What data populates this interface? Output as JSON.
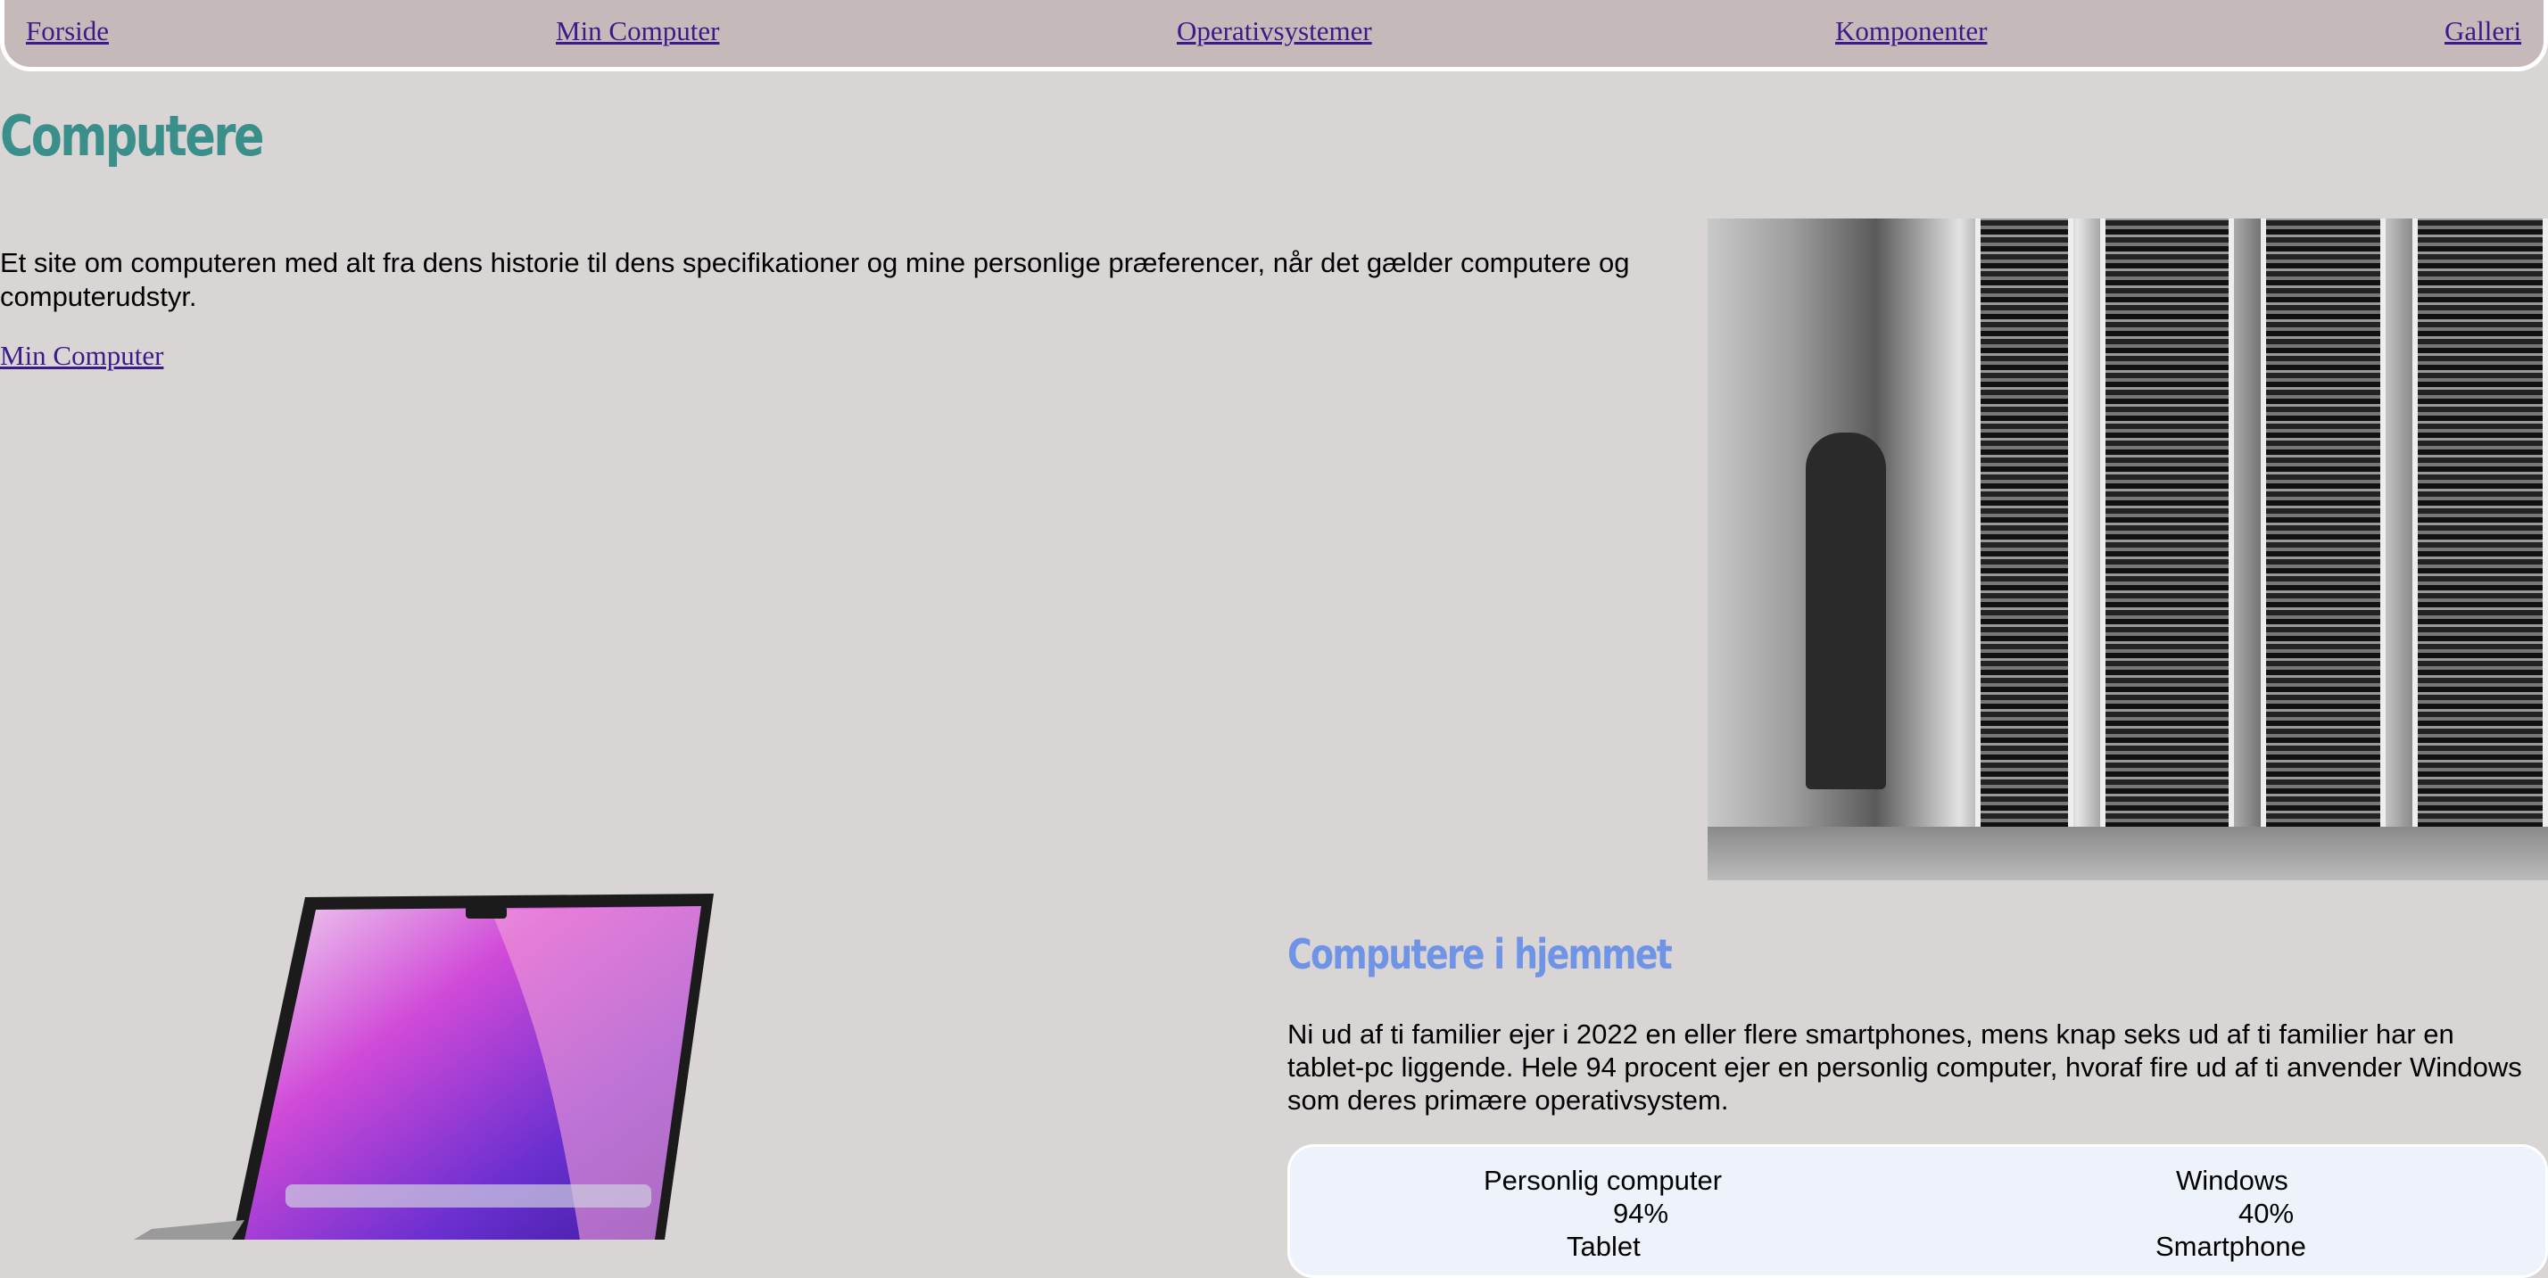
{
  "nav": {
    "items": [
      {
        "label": "Forside"
      },
      {
        "label": "Min Computer"
      },
      {
        "label": "Operativsystemer"
      },
      {
        "label": "Komponenter"
      },
      {
        "label": "Galleri"
      }
    ]
  },
  "main": {
    "title": "Computere",
    "intro": "Et site om computeren med alt fra dens historie til dens specifikationer og mine personlige præferencer, når det gælder computere og computerudstyr.",
    "link": "Min Computer"
  },
  "home": {
    "title": "Computere i hjemmet",
    "text": "Ni ud af ti familier ejer i 2022 en eller flere smartphones, mens knap seks ud af ti familier har en tablet-pc liggende. Hele 94 procent ejer en personlig computer, hvoraf fire ud af ti anvender Windows som deres primære operativsystem.",
    "stats": [
      {
        "label": "Personlig computer",
        "value": "94%"
      },
      {
        "label": "Windows",
        "value": "40%"
      },
      {
        "label": "Tablet"
      },
      {
        "label": "Smartphone"
      }
    ]
  },
  "images": {
    "photo": "historic-mainframe-computer-photo",
    "laptop": "laptop-macos-wallpaper"
  }
}
